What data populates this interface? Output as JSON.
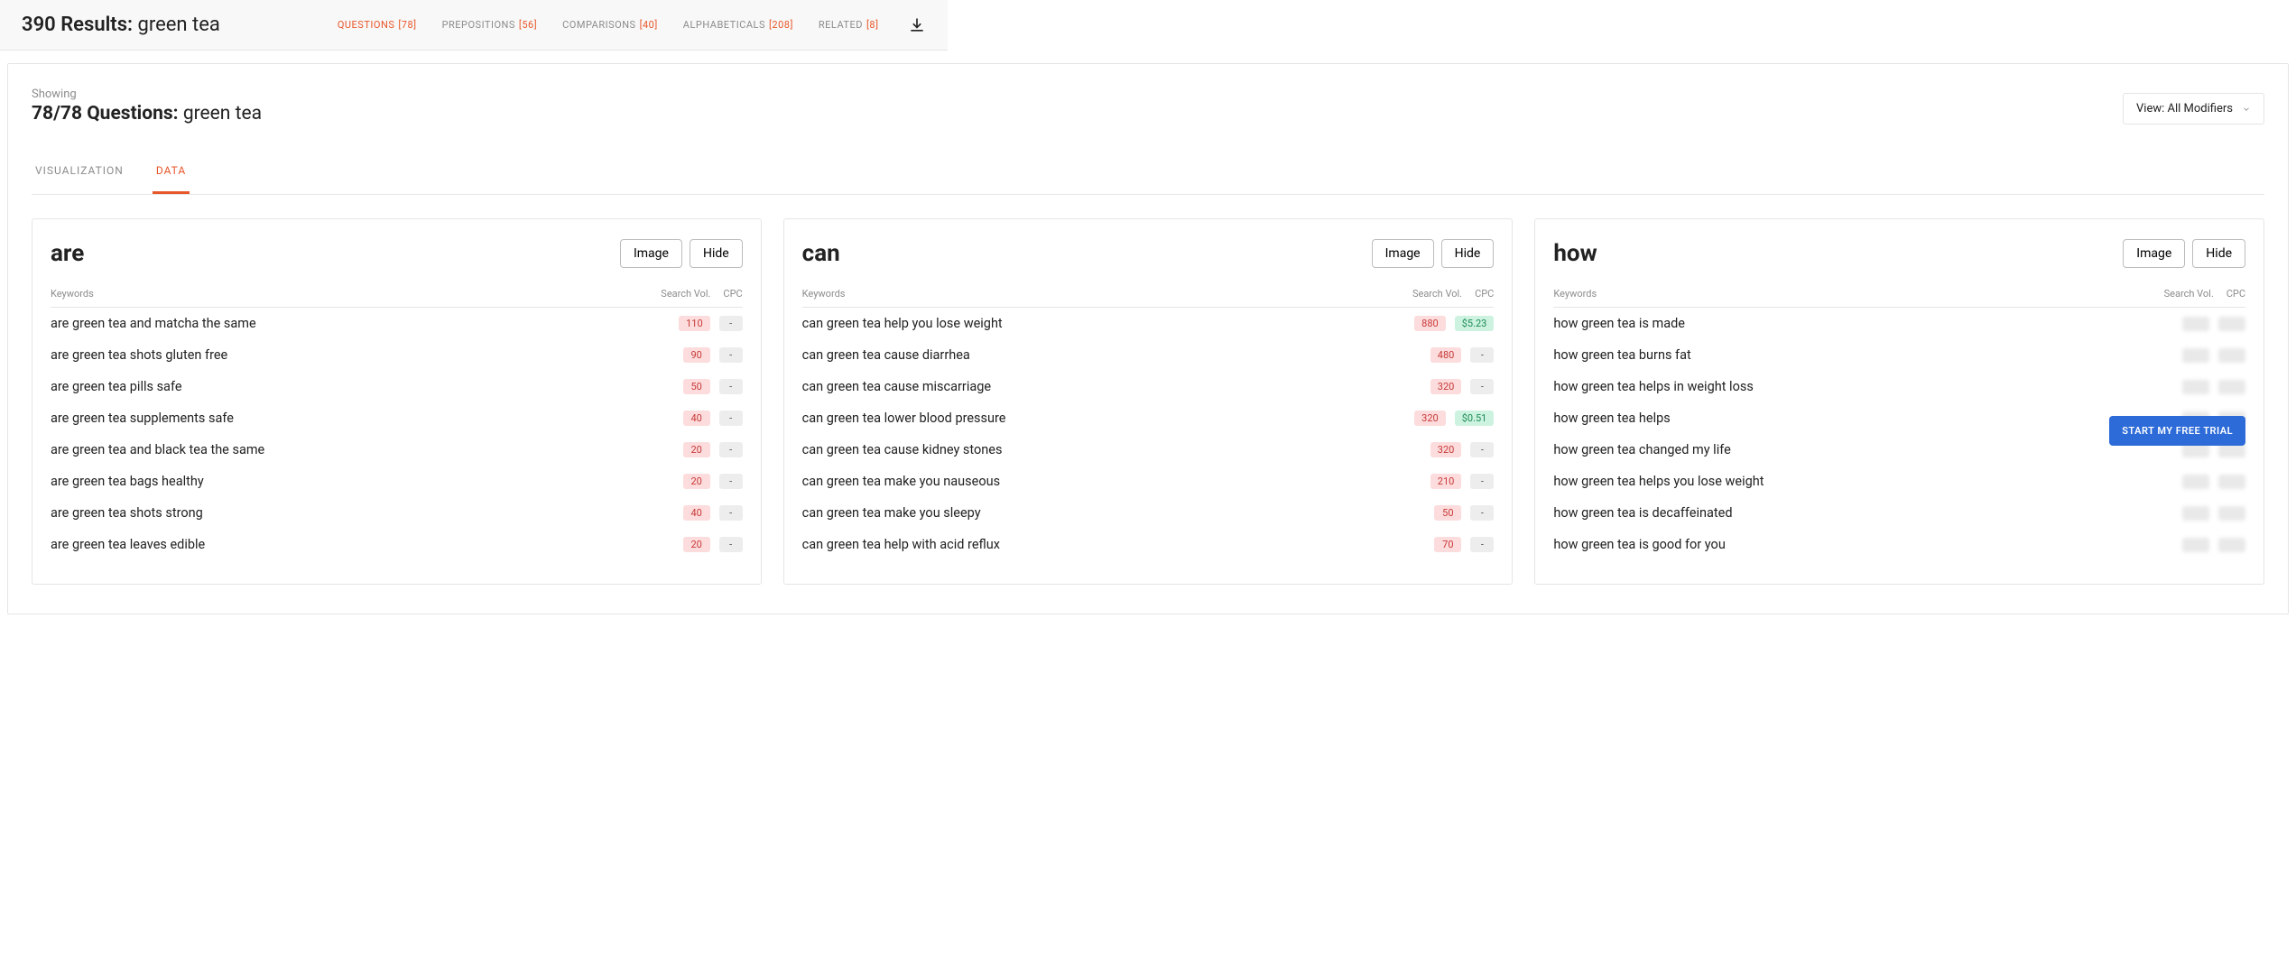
{
  "header": {
    "results_count": "390",
    "results_label": "Results:",
    "query": "green tea",
    "tabs": [
      {
        "label": "QUESTIONS",
        "count": "[78]",
        "active": true
      },
      {
        "label": "PREPOSITIONS",
        "count": "[56]",
        "active": false
      },
      {
        "label": "COMPARISONS",
        "count": "[40]",
        "active": false
      },
      {
        "label": "ALPHABETICALS",
        "count": "[208]",
        "active": false
      },
      {
        "label": "RELATED",
        "count": "[8]",
        "active": false
      }
    ],
    "download_icon": "download-icon"
  },
  "panel": {
    "showing_label": "Showing",
    "count_line": "78/78 Questions:",
    "query": "green tea",
    "view_label": "View: All Modifiers",
    "subtabs": [
      {
        "label": "VISUALIZATION",
        "active": false
      },
      {
        "label": "DATA",
        "active": true
      }
    ]
  },
  "columns": {
    "keywords": "Keywords",
    "vol": "Search Vol.",
    "cpc": "CPC"
  },
  "buttons": {
    "image": "Image",
    "hide": "Hide",
    "cta": "START MY FREE TRIAL"
  },
  "cards": [
    {
      "title": "are",
      "locked": false,
      "rows": [
        {
          "kw": "are green tea and matcha the same",
          "vol": "110",
          "cpc": "-"
        },
        {
          "kw": "are green tea shots gluten free",
          "vol": "90",
          "cpc": "-"
        },
        {
          "kw": "are green tea pills safe",
          "vol": "50",
          "cpc": "-"
        },
        {
          "kw": "are green tea supplements safe",
          "vol": "40",
          "cpc": "-"
        },
        {
          "kw": "are green tea and black tea the same",
          "vol": "20",
          "cpc": "-"
        },
        {
          "kw": "are green tea bags healthy",
          "vol": "20",
          "cpc": "-"
        },
        {
          "kw": "are green tea shots strong",
          "vol": "40",
          "cpc": "-"
        },
        {
          "kw": "are green tea leaves edible",
          "vol": "20",
          "cpc": "-"
        }
      ]
    },
    {
      "title": "can",
      "locked": false,
      "rows": [
        {
          "kw": "can green tea help you lose weight",
          "vol": "880",
          "cpc": "$5.23",
          "cpc_green": true
        },
        {
          "kw": "can green tea cause diarrhea",
          "vol": "480",
          "cpc": "-"
        },
        {
          "kw": "can green tea cause miscarriage",
          "vol": "320",
          "cpc": "-"
        },
        {
          "kw": "can green tea lower blood pressure",
          "vol": "320",
          "cpc": "$0.51",
          "cpc_green": true
        },
        {
          "kw": "can green tea cause kidney stones",
          "vol": "320",
          "cpc": "-"
        },
        {
          "kw": "can green tea make you nauseous",
          "vol": "210",
          "cpc": "-"
        },
        {
          "kw": "can green tea make you sleepy",
          "vol": "50",
          "cpc": "-"
        },
        {
          "kw": "can green tea help with acid reflux",
          "vol": "70",
          "cpc": "-"
        }
      ]
    },
    {
      "title": "how",
      "locked": true,
      "rows": [
        {
          "kw": "how green tea is made"
        },
        {
          "kw": "how green tea burns fat"
        },
        {
          "kw": "how green tea helps in weight loss"
        },
        {
          "kw": "how green tea helps"
        },
        {
          "kw": "how green tea changed my life"
        },
        {
          "kw": "how green tea helps you lose weight"
        },
        {
          "kw": "how green tea is decaffeinated"
        },
        {
          "kw": "how green tea is good for you"
        }
      ]
    }
  ]
}
